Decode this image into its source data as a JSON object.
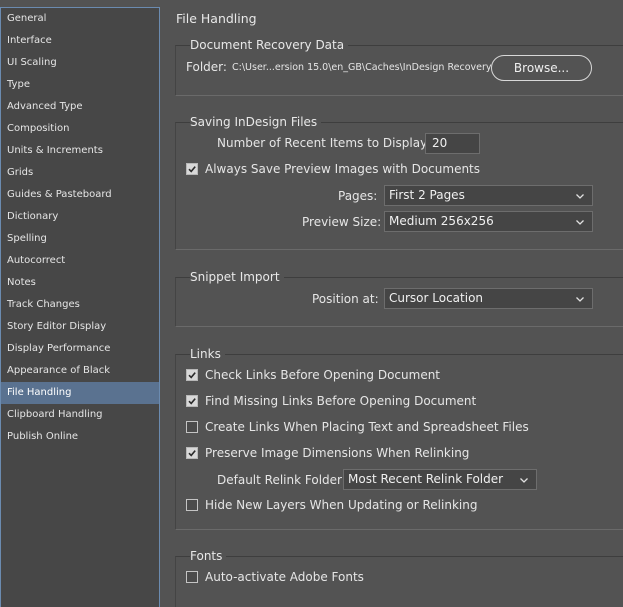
{
  "sidebar": {
    "items": [
      {
        "label": "General"
      },
      {
        "label": "Interface"
      },
      {
        "label": "UI Scaling"
      },
      {
        "label": "Type"
      },
      {
        "label": "Advanced Type"
      },
      {
        "label": "Composition"
      },
      {
        "label": "Units & Increments"
      },
      {
        "label": "Grids"
      },
      {
        "label": "Guides & Pasteboard"
      },
      {
        "label": "Dictionary"
      },
      {
        "label": "Spelling"
      },
      {
        "label": "Autocorrect"
      },
      {
        "label": "Notes"
      },
      {
        "label": "Track Changes"
      },
      {
        "label": "Story Editor Display"
      },
      {
        "label": "Display Performance"
      },
      {
        "label": "Appearance of Black"
      },
      {
        "label": "File Handling"
      },
      {
        "label": "Clipboard Handling"
      },
      {
        "label": "Publish Online"
      }
    ],
    "selected": "File Handling"
  },
  "page_title": "File Handling",
  "recovery": {
    "title": "Document Recovery Data",
    "folder_label": "Folder:",
    "folder_path": "C:\\User...ersion 15.0\\en_GB\\Caches\\InDesign Recovery",
    "browse_label": "Browse..."
  },
  "saving": {
    "title": "Saving InDesign Files",
    "recent_label": "Number of Recent Items to Display:",
    "recent_value": "20",
    "preview_check_label": "Always Save Preview Images with Documents",
    "pages_label": "Pages:",
    "pages_value": "First 2 Pages",
    "preview_size_label": "Preview Size:",
    "preview_size_value": "Medium 256x256"
  },
  "snippet": {
    "title": "Snippet Import",
    "position_label": "Position at:",
    "position_value": "Cursor Location"
  },
  "links": {
    "title": "Links",
    "check_links": "Check Links Before Opening Document",
    "find_missing": "Find Missing Links Before Opening Document",
    "create_links": "Create Links When Placing Text and Spreadsheet Files",
    "preserve_dims": "Preserve Image Dimensions When Relinking",
    "relink_folder_label": "Default Relink Folder:",
    "relink_folder_value": "Most Recent Relink Folder",
    "hide_layers": "Hide New Layers When Updating or Relinking"
  },
  "fonts": {
    "title": "Fonts",
    "auto_activate": "Auto-activate Adobe Fonts"
  }
}
